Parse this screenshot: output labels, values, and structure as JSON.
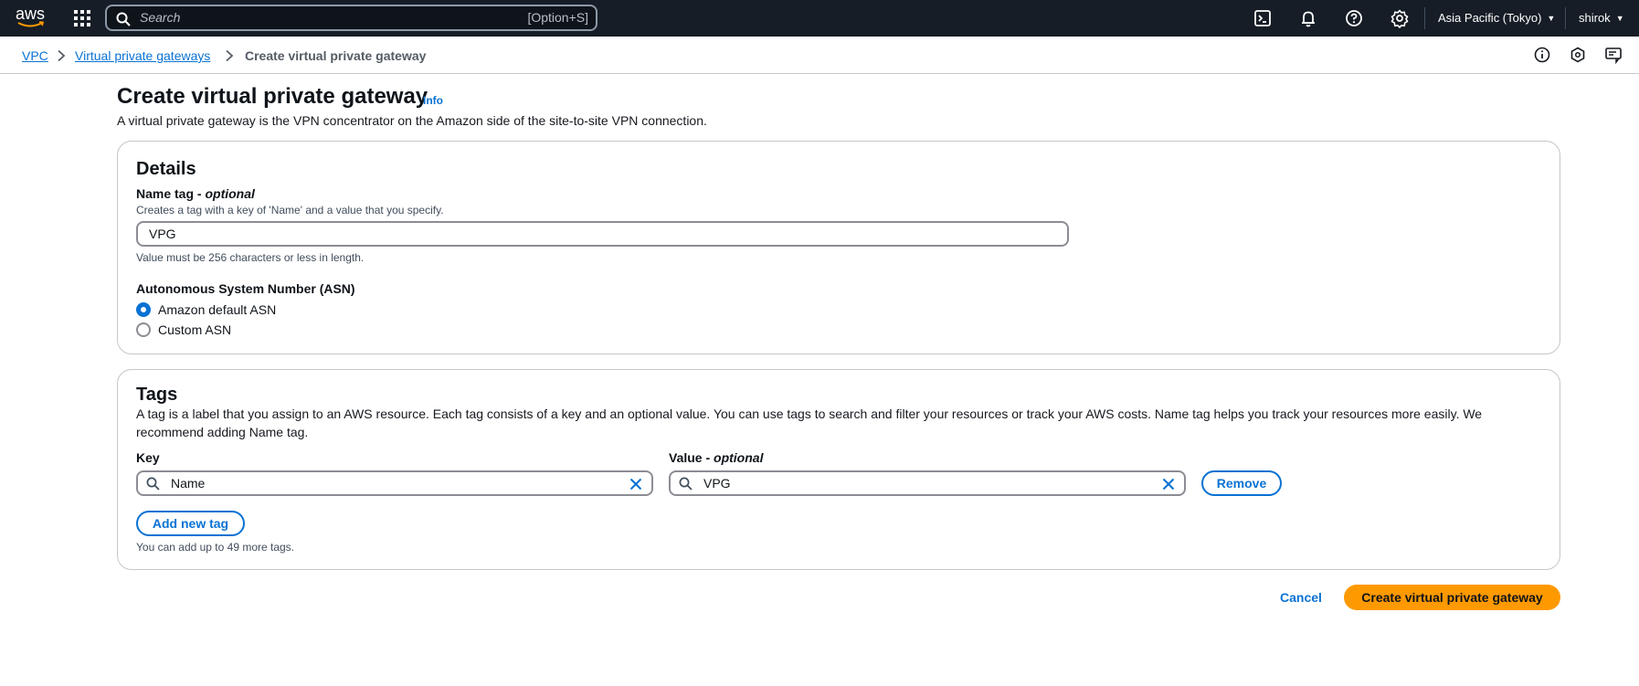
{
  "topnav": {
    "logo": "aws",
    "search_placeholder": "Search",
    "search_shortcut": "[Option+S]",
    "region": "Asia Pacific (Tokyo)",
    "user": "shirok"
  },
  "breadcrumb": {
    "items": [
      "VPC",
      "Virtual private gateways"
    ],
    "current": "Create virtual private gateway"
  },
  "page": {
    "title": "Create virtual private gateway",
    "info": "Info",
    "description": "A virtual private gateway is the VPN concentrator on the Amazon side of the site-to-site VPN connection."
  },
  "details": {
    "heading": "Details",
    "name_tag_label": "Name tag - ",
    "name_tag_optional": "optional",
    "name_tag_description": "Creates a tag with a key of 'Name' and a value that you specify.",
    "name_tag_value": "VPG",
    "name_tag_constraint": "Value must be 256 characters or less in length.",
    "asn_label": "Autonomous System Number (ASN)",
    "asn_options": [
      "Amazon default ASN",
      "Custom ASN"
    ],
    "asn_selected": "Amazon default ASN"
  },
  "tags": {
    "heading": "Tags",
    "description": "A tag is a label that you assign to an AWS resource. Each tag consists of a key and an optional value. You can use tags to search and filter your resources or track your AWS costs. Name tag helps you track your resources more easily. We recommend adding Name tag.",
    "key_label": "Key",
    "value_label": "Value - ",
    "value_optional": "optional",
    "rows": [
      {
        "key": "Name",
        "value": "VPG",
        "remove_label": "Remove"
      }
    ],
    "add_label": "Add new tag",
    "limit_text": "You can add up to 49 more tags."
  },
  "actions": {
    "cancel": "Cancel",
    "submit": "Create virtual private gateway"
  },
  "colors": {
    "nav_bg": "#161d26",
    "link": "#0972d3",
    "primary": "#ff9900",
    "border": "#c6c6cd"
  },
  "icons": [
    "aws-logo",
    "apps-grid-icon",
    "search-icon",
    "cloudshell-icon",
    "notifications-bell-icon",
    "help-icon",
    "settings-gear-icon",
    "chevron-right-icon",
    "info-icon",
    "hexagon-icon",
    "feedback-icon",
    "clear-x-icon"
  ]
}
